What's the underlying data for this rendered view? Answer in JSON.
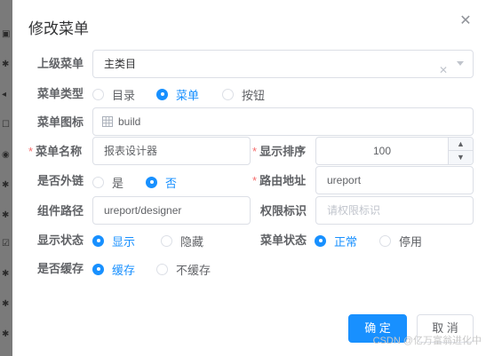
{
  "dialog": {
    "title": "修改菜单",
    "close_icon": "close-icon"
  },
  "form": {
    "parent_menu": {
      "label": "上级菜单",
      "value": "主类目"
    },
    "menu_type": {
      "label": "菜单类型",
      "options": [
        "目录",
        "菜单",
        "按钮"
      ],
      "selected": "菜单"
    },
    "menu_icon": {
      "label": "菜单图标",
      "value": "build",
      "icon": "grid-icon"
    },
    "menu_name": {
      "label": "菜单名称",
      "value": "报表设计器",
      "required": "*"
    },
    "display_order": {
      "label": "显示排序",
      "value": "100",
      "required": "*"
    },
    "is_external": {
      "label": "是否外链",
      "options": [
        "是",
        "否"
      ],
      "selected": "否"
    },
    "route_path": {
      "label": "路由地址",
      "value": "ureport",
      "required": "*"
    },
    "component_path": {
      "label": "组件路径",
      "value": "ureport/designer"
    },
    "permission": {
      "label": "权限标识",
      "placeholder": "请权限标识"
    },
    "display_status": {
      "label": "显示状态",
      "options": [
        "显示",
        "隐藏"
      ],
      "selected": "显示"
    },
    "menu_status": {
      "label": "菜单状态",
      "options": [
        "正常",
        "停用"
      ],
      "selected": "正常"
    },
    "is_cached": {
      "label": "是否缓存",
      "options": [
        "缓存",
        "不缓存"
      ],
      "selected": "缓存"
    }
  },
  "footer": {
    "confirm_label": "确 定",
    "cancel_label": "取 消"
  },
  "watermark": "CSDN @亿万富翁进化中",
  "colors": {
    "primary": "#1890ff",
    "required": "#f56c6c",
    "border": "#dcdfe6"
  }
}
